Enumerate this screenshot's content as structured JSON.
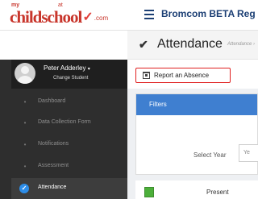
{
  "header": {
    "logo": {
      "my": "my",
      "child": "child",
      "at": "at",
      "school": "school",
      "com": ".com"
    },
    "app_name": "Bromcom BETA Reg"
  },
  "page": {
    "title": "Attendance",
    "subtitle": "Attendance ›"
  },
  "user": {
    "name": "Peter Adderley",
    "caret": "▾",
    "change_label": "Change Student"
  },
  "sidebar": {
    "items": [
      {
        "label": "Dashboard",
        "icon": "dashboard-icon",
        "glyph": "•"
      },
      {
        "label": "Data Collection Form",
        "icon": "person-icon",
        "glyph": "•"
      },
      {
        "label": "Notifications",
        "icon": "bell-icon",
        "glyph": "•"
      },
      {
        "label": "Assessment",
        "icon": "pencil-icon",
        "glyph": "•"
      },
      {
        "label": "Attendance",
        "icon": "check-icon",
        "glyph": "✓",
        "active": true
      }
    ]
  },
  "actions": {
    "report_absence": "Report an Absence"
  },
  "filters": {
    "heading": "Filters",
    "year_label": "Select Year",
    "year_value": "Ye"
  },
  "legend": {
    "present_label": "Present",
    "present_color": "#4caf3a"
  },
  "colors": {
    "brand_red": "#c8352b",
    "nav_blue": "#1c3f74",
    "filter_header": "#3f7fd0",
    "sidebar_bg": "#2e2e2e",
    "highlight_red": "#e02020"
  }
}
